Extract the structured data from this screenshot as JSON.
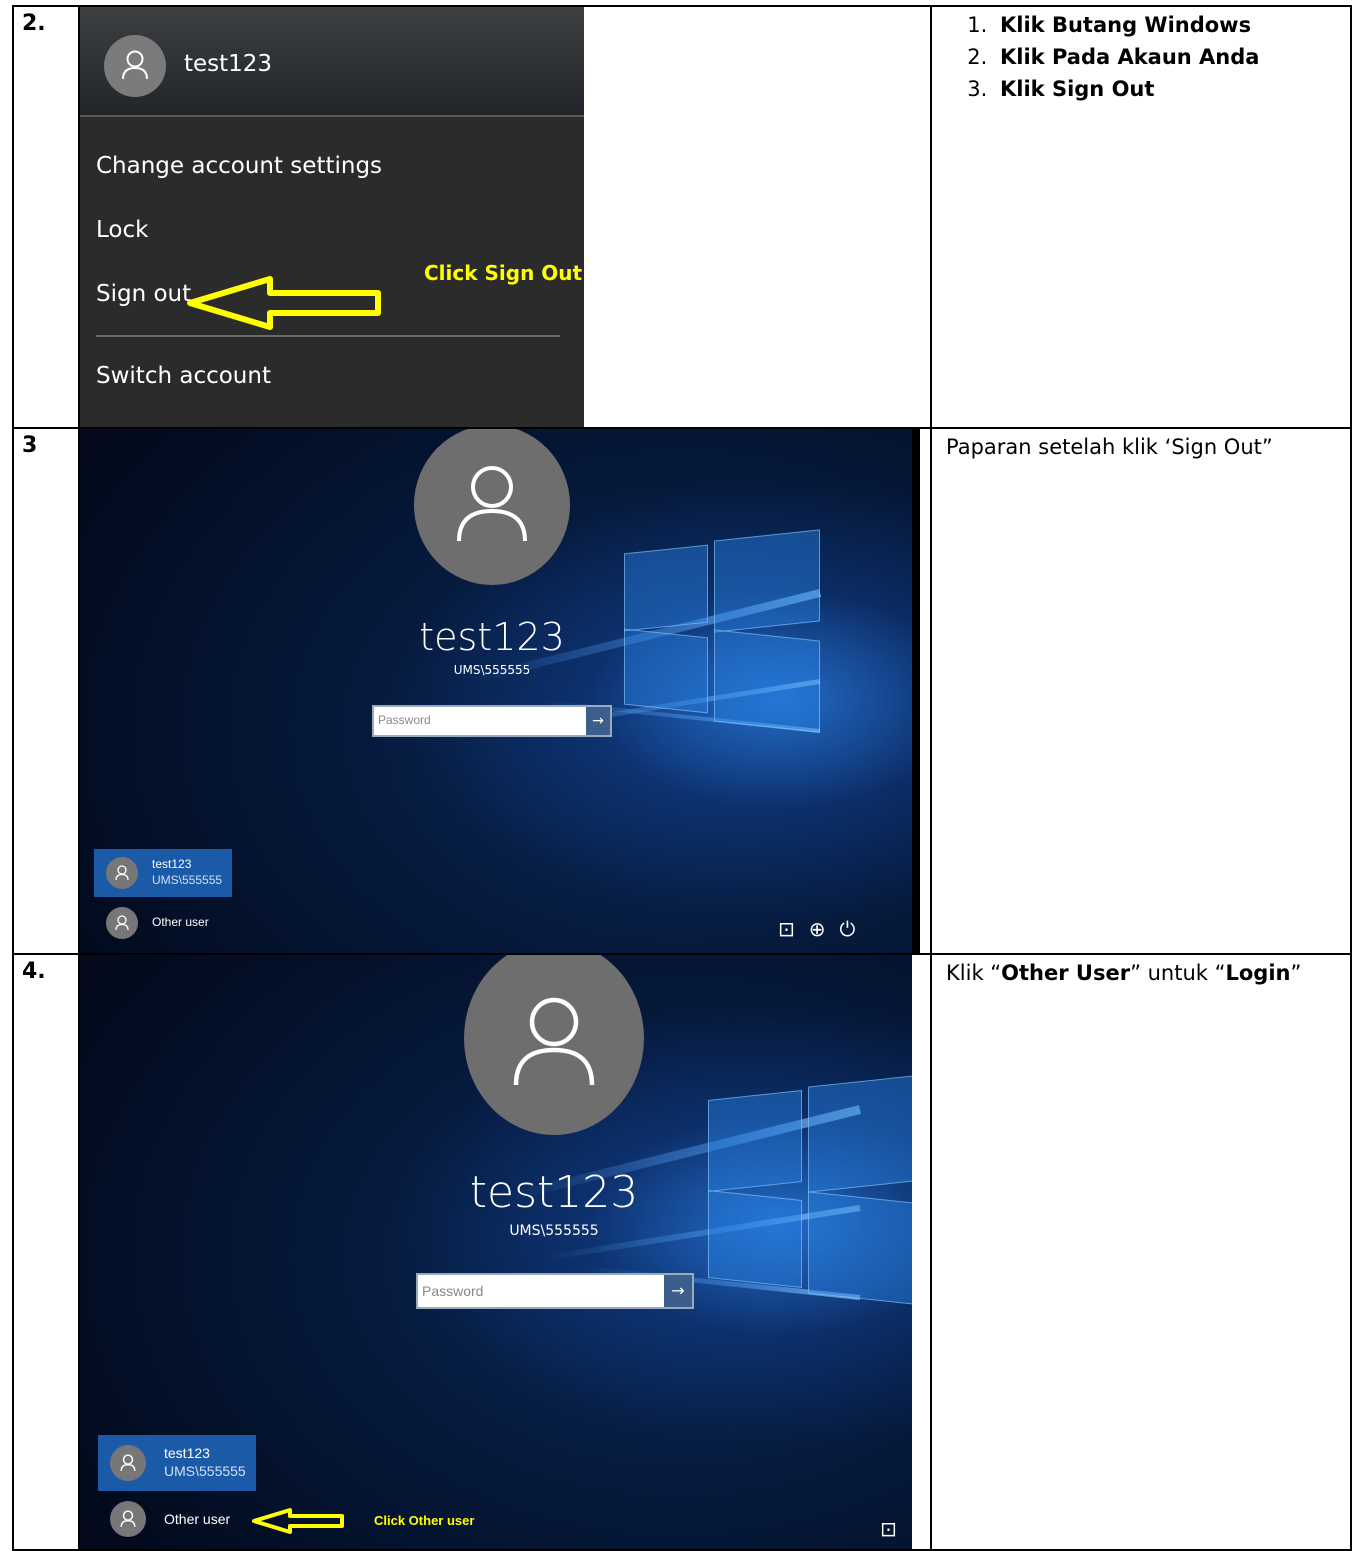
{
  "rows": [
    {
      "number": "2.",
      "menu": {
        "username": "test123",
        "items": [
          "Change account settings",
          "Lock",
          "Sign out",
          "Switch account"
        ],
        "annotation": "Click Sign Out"
      },
      "steps": [
        "Klik Butang Windows",
        "Klik Pada Akaun Anda",
        "Klik Sign Out"
      ]
    },
    {
      "number": "3",
      "login": {
        "name": "test123",
        "domain": "UMS\\555555",
        "password_placeholder": "Password",
        "tile_name": "test123",
        "tile_domain": "UMS\\555555",
        "other_user": "Other user"
      },
      "description": "Paparan setelah klik ‘Sign Out”"
    },
    {
      "number": "4.",
      "login": {
        "name": "test123",
        "domain": "UMS\\555555",
        "password_placeholder": "Password",
        "tile_name": "test123",
        "tile_domain": "UMS\\555555",
        "other_user": "Other user",
        "annotation": "Click Other user"
      },
      "description": {
        "p1": "Klik “",
        "b1": "Other User",
        "p2": "” untuk “",
        "b2": "Login",
        "p3": "”"
      }
    }
  ],
  "icons": {
    "avatar": "user-silhouette-icon",
    "arrow": "right-arrow-icon",
    "network": "network-icon",
    "accessibility": "ease-of-access-icon",
    "power": "power-icon"
  },
  "colors": {
    "annotation": "#ffff00",
    "menu_bg": "#2b2b2b",
    "tile_selected": "#1a5aa6"
  }
}
